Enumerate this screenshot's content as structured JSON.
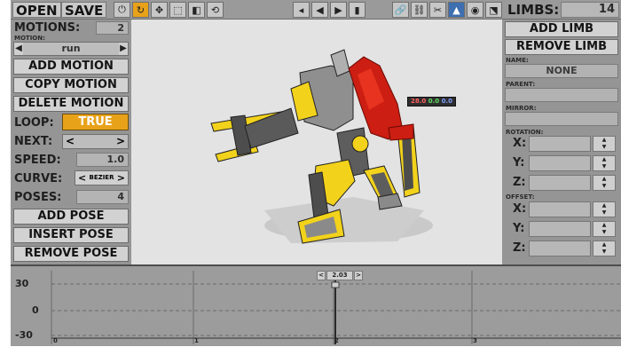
{
  "toolbar": {
    "open_label": "OPEN",
    "save_label": "SAVE",
    "limbs_label": "LIMBS:",
    "limbs_count": "14",
    "icons": [
      "power-icon",
      "rotate-icon",
      "move-icon",
      "scale-icon",
      "mirror-icon",
      "reset-icon",
      "skip-back-icon",
      "step-back-icon",
      "play-icon",
      "step-forward-icon",
      "link-icon",
      "link-child-icon",
      "unlink-icon",
      "hat-icon",
      "target-icon",
      "select-icon"
    ]
  },
  "left": {
    "motions_label": "MOTIONS:",
    "motions_count": "2",
    "motion_caption": "MOTION:",
    "motion_value": "run",
    "add_motion": "ADD MOTION",
    "copy_motion": "COPY MOTION",
    "delete_motion": "DELETE MOTION",
    "loop_label": "LOOP:",
    "loop_value": "TRUE",
    "next_label": "NEXT:",
    "next_left": "<",
    "next_right": ">",
    "speed_label": "SPEED:",
    "speed_value": "1.0",
    "curve_label": "CURVE:",
    "curve_value": "BEZIER",
    "poses_label": "POSES:",
    "poses_value": "4",
    "add_pose": "ADD POSE",
    "insert_pose": "INSERT POSE",
    "remove_pose": "REMOVE POSE"
  },
  "right": {
    "add_limb": "ADD LIMB",
    "remove_limb": "REMOVE LIMB",
    "name_caption": "NAME:",
    "name_value": "NONE",
    "parent_caption": "PARENT:",
    "mirror_caption": "MIRROR:",
    "rotation_caption": "ROTATION:",
    "offset_caption": "OFFSET:",
    "x": "X:",
    "y": "Y:",
    "z": "Z:"
  },
  "viewport": {
    "readout_x": "28.0",
    "readout_y": "0.0",
    "readout_z": "0.0"
  },
  "timeline": {
    "y_top": "30",
    "y_mid": "0",
    "y_bottom": "-30",
    "ticks": [
      "0",
      "1",
      "2",
      "3"
    ],
    "current_frame": "2.03",
    "prev": "<",
    "next": ">"
  },
  "colors": {
    "accent": "#e8a21a",
    "panel": "#959595",
    "viewport_bg": "#e3e3e3",
    "robot_yellow": "#f2d21b",
    "robot_red": "#cc1e12"
  }
}
